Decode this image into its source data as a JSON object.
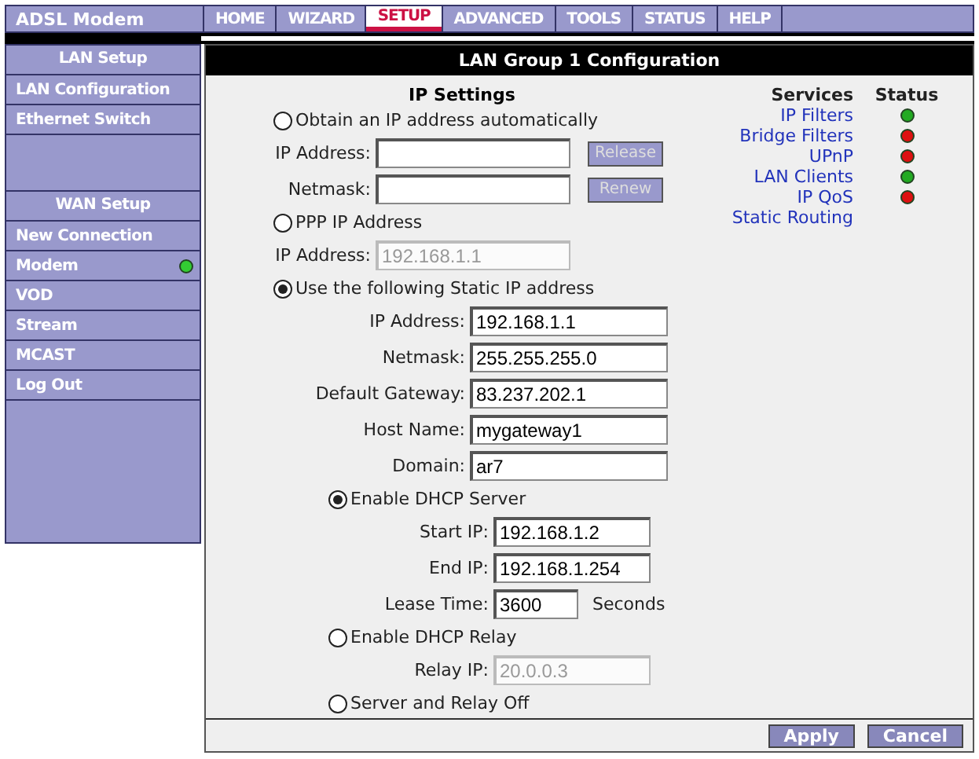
{
  "header": {
    "brand": "ADSL Modem",
    "tabs": [
      {
        "label": "HOME",
        "selected": false
      },
      {
        "label": "WIZARD",
        "selected": false
      },
      {
        "label": "SETUP",
        "selected": true
      },
      {
        "label": "ADVANCED",
        "selected": false
      },
      {
        "label": "TOOLS",
        "selected": false
      },
      {
        "label": "STATUS",
        "selected": false
      },
      {
        "label": "HELP",
        "selected": false
      }
    ]
  },
  "sidebar": {
    "groups": [
      {
        "title": "LAN Setup",
        "items": [
          {
            "label": "LAN Configuration"
          },
          {
            "label": "Ethernet Switch"
          }
        ]
      },
      {
        "title": "WAN Setup",
        "items": [
          {
            "label": "New Connection"
          },
          {
            "label": "Modem",
            "color": "#33cc33"
          },
          {
            "label": "VOD"
          },
          {
            "label": "Stream"
          },
          {
            "label": "MCAST"
          },
          {
            "label": "Log Out"
          }
        ]
      }
    ]
  },
  "panel": {
    "title": "LAN Group 1 Configuration",
    "ip_settings": {
      "title": "IP Settings",
      "options": [
        {
          "label": "Obtain an IP address automatically",
          "selected": false,
          "kind": "compact",
          "fields": [
            {
              "label": "IP Address:",
              "disabled": false,
              "button": "Release"
            },
            {
              "label": "Netmask:",
              "disabled": false,
              "button": "Renew"
            }
          ]
        },
        {
          "label": "PPP IP Address",
          "selected": false,
          "kind": "compact",
          "fields": [
            {
              "label": "IP Address:",
              "value": "192.168.1.1",
              "disabled": true
            }
          ]
        },
        {
          "label": "Use the following Static IP address",
          "selected": true,
          "kind": "wide",
          "fields": [
            {
              "label": "IP Address:",
              "value": "192.168.1.1",
              "disabled": false
            },
            {
              "label": "Netmask:",
              "value": "255.255.255.0",
              "disabled": false
            },
            {
              "label": "Default Gateway:",
              "value": "83.237.202.1",
              "disabled": false
            },
            {
              "label": "Host Name:",
              "value": "mygateway1",
              "disabled": false
            },
            {
              "label": "Domain:",
              "value": "ar7",
              "disabled": false
            }
          ],
          "children": [
            {
              "label": "Enable DHCP Server",
              "selected": true,
              "kind": "nested",
              "fields": [
                {
                  "label": "Start IP:",
                  "value": "192.168.1.2",
                  "disabled": false
                },
                {
                  "label": "End IP:",
                  "value": "192.168.1.254",
                  "disabled": false
                },
                {
                  "label": "Lease Time:",
                  "value": "3600",
                  "disabled": false,
                  "unit": "Seconds"
                }
              ]
            },
            {
              "label": "Enable DHCP Relay",
              "selected": false,
              "kind": "nested",
              "fields": [
                {
                  "label": "Relay IP:",
                  "value": "20.0.0.3",
                  "disabled": true
                }
              ]
            },
            {
              "label": "Server and Relay Off",
              "selected": false,
              "kind": "nested"
            }
          ]
        }
      ]
    },
    "services": {
      "columns": [
        "Services",
        "Status"
      ],
      "rows": [
        {
          "name": "IP Filters",
          "color": "#22aa22"
        },
        {
          "name": "Bridge Filters",
          "color": "#dd1111"
        },
        {
          "name": "UPnP",
          "color": "#dd1111"
        },
        {
          "name": "LAN Clients",
          "color": "#22aa22"
        },
        {
          "name": "IP QoS",
          "color": "#dd1111"
        },
        {
          "name": "Static Routing"
        }
      ]
    },
    "buttons": [
      "Apply",
      "Cancel"
    ]
  }
}
